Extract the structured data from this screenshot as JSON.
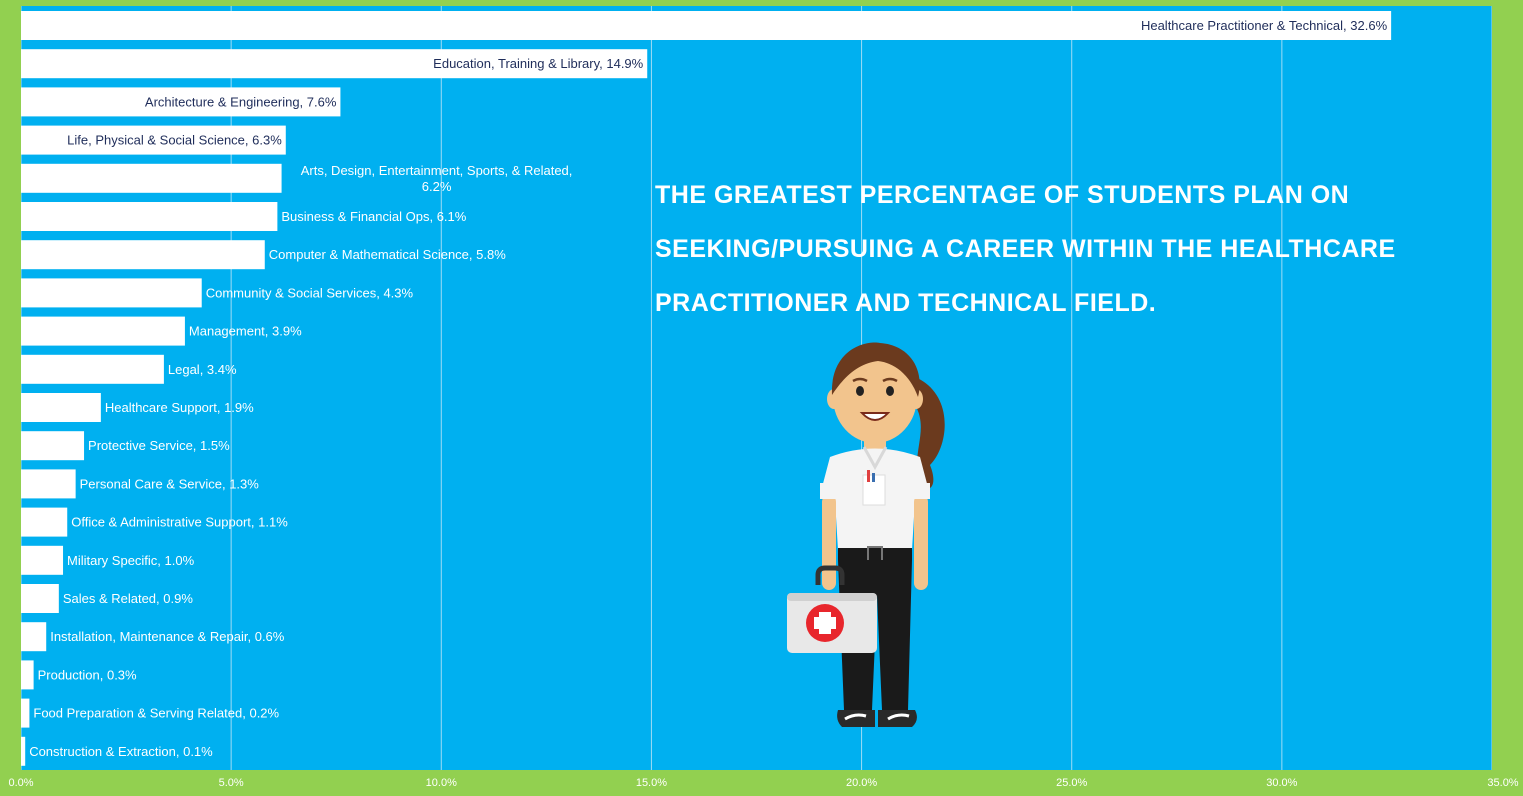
{
  "headline": "THE GREATEST PERCENTAGE OF STUDENTS PLAN ON SEEKING/PURSUING A CAREER WITHIN THE HEALTHCARE PRACTITIONER AND TECHNICAL FIELD.",
  "illustration": "nurse-with-first-aid-kit",
  "colors": {
    "background": "#92d050",
    "plot": "#00b0f0",
    "bar": "#ffffff",
    "label_dark": "#1f2d5a",
    "label_light": "#ffffff"
  },
  "chart_data": {
    "type": "bar",
    "orientation": "horizontal",
    "categories": [
      "Healthcare Practitioner & Technical",
      "Education, Training & Library",
      "Architecture & Engineering",
      "Life, Physical & Social Science",
      "Arts, Design, Entertainment, Sports, & Related",
      "Business & Financial Ops",
      "Computer & Mathematical Science",
      "Community & Social Services",
      "Management",
      "Legal",
      "Healthcare Support",
      "Protective Service",
      "Personal Care & Service",
      "Office & Administrative Support",
      "Military Specific",
      "Sales & Related",
      "Installation, Maintenance & Repair",
      "Production",
      "Food Preparation & Serving Related",
      "Construction & Extraction"
    ],
    "values": [
      32.6,
      14.9,
      7.6,
      6.3,
      6.2,
      6.1,
      5.8,
      4.3,
      3.9,
      3.4,
      1.9,
      1.5,
      1.3,
      1.1,
      1.0,
      0.9,
      0.6,
      0.3,
      0.2,
      0.1
    ],
    "data_labels": [
      "Healthcare Practitioner & Technical, 32.6%",
      "Education, Training & Library, 14.9%",
      "Architecture & Engineering, 7.6%",
      "Life, Physical & Social Science, 6.3%",
      "Arts, Design, Entertainment, Sports, & Related, 6.2%",
      "Business & Financial Ops, 6.1%",
      "Computer & Mathematical Science, 5.8%",
      "Community & Social Services, 4.3%",
      "Management, 3.9%",
      "Legal, 3.4%",
      "Healthcare Support, 1.9%",
      "Protective Service, 1.5%",
      "Personal Care & Service, 1.3%",
      "Office & Administrative Support, 1.1%",
      "Military Specific, 1.0%",
      "Sales & Related, 0.9%",
      "Installation, Maintenance & Repair, 0.6%",
      "Production, 0.3%",
      "Food Preparation & Serving Related, 0.2%",
      "Construction & Extraction, 0.1%"
    ],
    "x_ticks": [
      "0.0%",
      "5.0%",
      "10.0%",
      "15.0%",
      "20.0%",
      "25.0%",
      "30.0%",
      "35.0%"
    ],
    "xlim": [
      0,
      35
    ],
    "grid": true,
    "title": "",
    "xlabel": "",
    "ylabel": ""
  }
}
